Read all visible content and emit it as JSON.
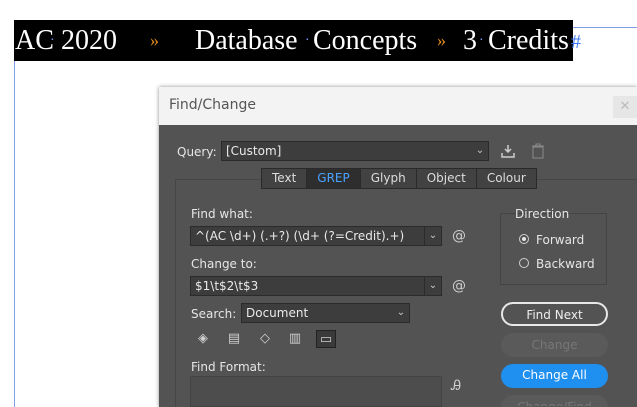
{
  "document": {
    "heading_parts": [
      "AC",
      "2020",
      "»",
      "Database",
      "Concepts",
      "»",
      "3",
      "Credits"
    ],
    "end_marker": "#"
  },
  "dialog": {
    "title": "Find/Change",
    "close_glyph": "✕",
    "query": {
      "label": "Query:",
      "value": "[Custom]"
    },
    "tabs": [
      {
        "label": "Text",
        "active": false
      },
      {
        "label": "GREP",
        "active": true
      },
      {
        "label": "Glyph",
        "active": false
      },
      {
        "label": "Object",
        "active": false
      },
      {
        "label": "Colour",
        "active": false
      }
    ],
    "find_what": {
      "label": "Find what:",
      "value": "^(AC \\d+) (.+?) (\\d+ (?=Credit).+)"
    },
    "change_to": {
      "label": "Change to:",
      "value": "$1\\t$2\\t$3"
    },
    "special_char_glyph": "@",
    "search": {
      "label": "Search:",
      "value": "Document"
    },
    "find_format": {
      "label": "Find Format:"
    },
    "direction": {
      "label": "Direction",
      "options": [
        {
          "label": "Forward",
          "selected": true
        },
        {
          "label": "Backward",
          "selected": false
        }
      ]
    },
    "buttons": {
      "find_next": "Find Next",
      "change": "Change",
      "change_all": "Change All",
      "change_find": "Change/Find"
    }
  }
}
